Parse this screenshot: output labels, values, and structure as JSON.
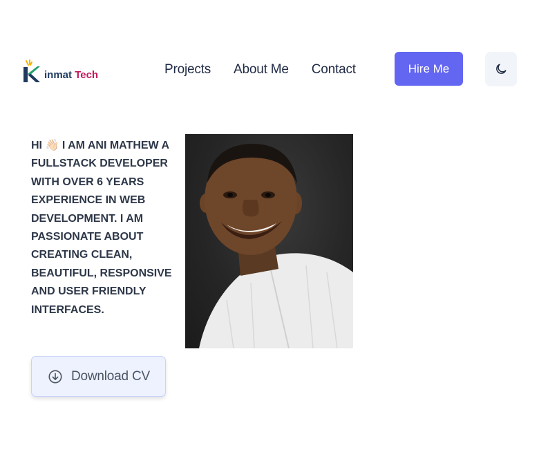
{
  "brand": {
    "name_part1": "inmat",
    "name_part2": "Tech",
    "accent": "#c2185b",
    "primary": "#1e3a5f"
  },
  "nav": {
    "items": [
      {
        "label": "Projects"
      },
      {
        "label": "About Me"
      },
      {
        "label": "Contact"
      }
    ],
    "hire_label": "Hire Me",
    "theme_icon": "moon-icon"
  },
  "hero": {
    "bio": "Hi 👋🏻 I am Ani Mathew a Fullstack Developer with over 6 years experience in web development. I am passionate about creating clean, beautiful, responsive and user friendly interfaces.",
    "download_label": "Download CV",
    "download_icon": "arrow-down-circle-icon"
  },
  "colors": {
    "accent": "#6366f1",
    "text": "#2d3748",
    "button_bg": "#eef2ff"
  }
}
